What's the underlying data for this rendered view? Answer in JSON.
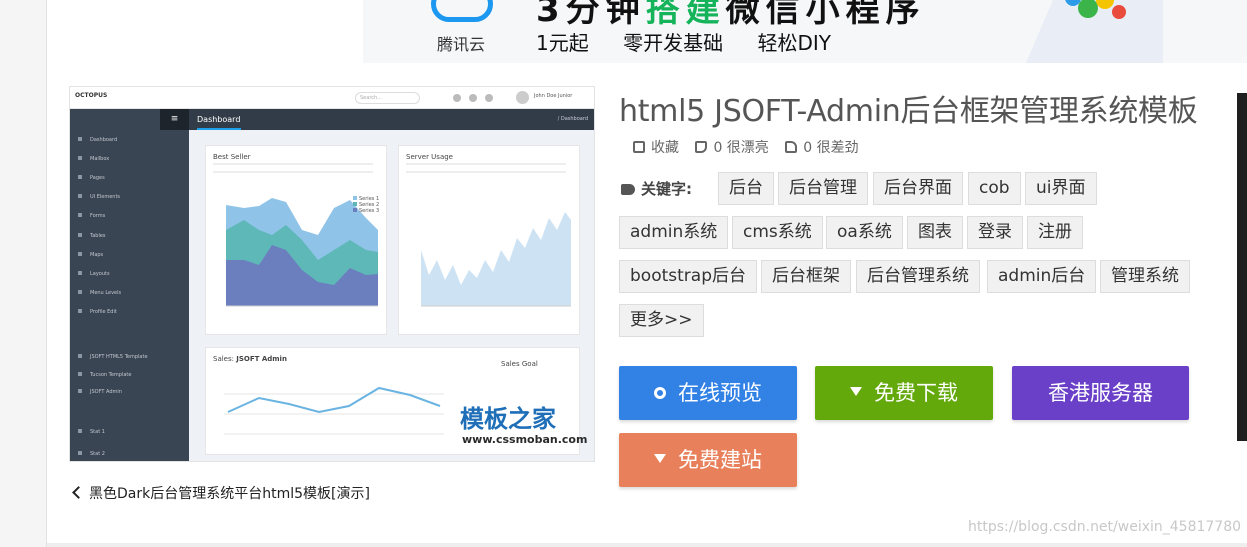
{
  "ad": {
    "brand": "腾讯云",
    "headline_a": "3分钟",
    "headline_b": "搭建",
    "headline_c": "微信小程序",
    "subs": [
      "1元起",
      "零开发基础",
      "轻松DIY"
    ]
  },
  "preview": {
    "logo": "OCTOPUS",
    "search_placeholder": "Search...",
    "user": "John Doe Junior",
    "bar_title": "Dashboard",
    "crumb": "/ Dashboard",
    "side_items": [
      "Dashboard",
      "Mailbox",
      "Pages",
      "UI Elements",
      "Forms",
      "Tables",
      "Maps",
      "Layouts",
      "Menu Levels",
      "Profile Edit",
      "JSOFT HTML5 Template",
      "Tucson Template",
      "JSOFT Admin",
      "Stat 1",
      "Stat 2"
    ],
    "card1_title": "Best Seller",
    "card2_title": "Server Usage",
    "card3_title": "Sales:",
    "card3_select": "JSOFT Admin",
    "card4_title": "Sales Goal",
    "legend": [
      "Series 1",
      "Series 2",
      "Series 3"
    ],
    "watermark": "模板之家",
    "watermark_url": "www.cssmoban.com"
  },
  "back_link": "黑色Dark后台管理系统平台html5模板[演示]",
  "title": "html5 JSOFT-Admin后台框架管理系统模板",
  "stats": {
    "fav": "收藏",
    "likes": "0 很漂亮",
    "dislikes": "0 很差劲"
  },
  "keywords_label": "关键字:",
  "tags": [
    "后台",
    "后台管理",
    "后台界面",
    "cob",
    "ui界面",
    "admin系统",
    "cms系统",
    "oa系统",
    "图表",
    "登录",
    "注册",
    "bootstrap后台",
    "后台框架",
    "后台管理系统",
    "admin后台",
    "管理系统",
    "更多>>"
  ],
  "buttons": {
    "preview": "在线预览",
    "download": "免费下载",
    "server": "香港服务器",
    "build": "免费建站"
  },
  "colors": {
    "preview": "#3282e6",
    "download": "#63a90c",
    "server": "#6b40c8",
    "build": "#e8805c"
  },
  "footer_url": "https://blog.csdn.net/weixin_45817780"
}
